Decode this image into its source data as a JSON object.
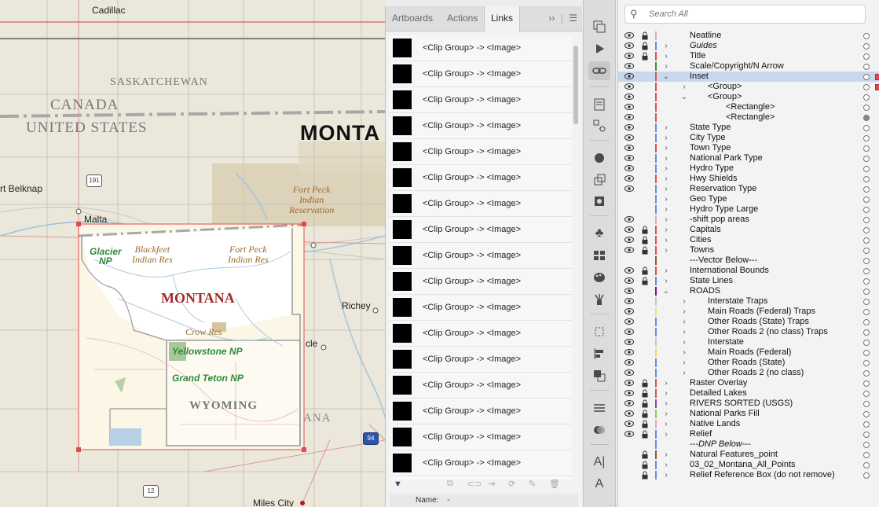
{
  "map": {
    "places": {
      "cadillac": "Cadillac",
      "fort_belknap": "rt Belknap",
      "malta": "Malta",
      "richey": "Richey",
      "circle": "cle",
      "miles_city": "Miles City"
    },
    "regions": {
      "saskatchewan": "SASKATCHEWAN",
      "canada": "CANADA",
      "united_states": "UNITED STATES",
      "montana_big": "MONTA",
      "ana_fragment": "ANA"
    },
    "reservations": {
      "fort_peck_main": "Fort Peck\nIndian\nReservation",
      "blackfeet": "Blackfeet\nIndian Res",
      "fort_peck_inset": "Fort Peck\nIndian Res",
      "crow": "Crow Res"
    },
    "parks": {
      "glacier": "Glacier\nNP",
      "yellowstone": "Yellowstone NP",
      "grand_teton": "Grand Teton NP"
    },
    "inset_labels": {
      "montana": "MONTANA",
      "wyoming": "WYOMING"
    },
    "shields": {
      "hwy191": "191",
      "hwy12": "12",
      "i94": "94"
    }
  },
  "links_panel": {
    "tabs": [
      "Artboards",
      "Actions",
      "Links"
    ],
    "active_tab": "Links",
    "items": [
      "<Clip Group> -> <Image>",
      "<Clip Group> -> <Image>",
      "<Clip Group> -> <Image>",
      "<Clip Group> -> <Image>",
      "<Clip Group> -> <Image>",
      "<Clip Group> -> <Image>",
      "<Clip Group> -> <Image>",
      "<Clip Group> -> <Image>",
      "<Clip Group> -> <Image>",
      "<Clip Group> -> <Image>",
      "<Clip Group> -> <Image>",
      "<Clip Group> -> <Image>",
      "<Clip Group> -> <Image>",
      "<Clip Group> -> <Image>",
      "<Clip Group> -> <Image>",
      "<Clip Group> -> <Image>",
      "<Clip Group> -> <Image>"
    ],
    "name_label": "Name:",
    "name_value": "-"
  },
  "layers_panel": {
    "search_placeholder": "Search All",
    "rows": [
      {
        "name": "Neatline",
        "indent": 0,
        "eye": true,
        "lock": true,
        "color": "#e8a0c8",
        "chev": ""
      },
      {
        "name": "Guides",
        "indent": 0,
        "eye": true,
        "lock": true,
        "color": "#6a8de0",
        "chev": ">",
        "italic": true
      },
      {
        "name": "Title",
        "indent": 0,
        "eye": true,
        "lock": true,
        "color": "#e05050",
        "chev": ">"
      },
      {
        "name": "Scale/Copyright/N Arrow",
        "indent": 0,
        "eye": true,
        "lock": false,
        "color": "#4a8a4a",
        "chev": ">"
      },
      {
        "name": "Inset",
        "indent": 0,
        "eye": true,
        "lock": false,
        "color": "#e05050",
        "chev": "v",
        "selected": true
      },
      {
        "name": "<Group>",
        "indent": 1,
        "eye": true,
        "lock": false,
        "color": "#e05050",
        "chev": ">"
      },
      {
        "name": "<Group>",
        "indent": 1,
        "eye": true,
        "lock": false,
        "color": "#e05050",
        "chev": "v"
      },
      {
        "name": "<Rectangle>",
        "indent": 2,
        "eye": true,
        "lock": false,
        "color": "#e05050",
        "chev": ""
      },
      {
        "name": "<Rectangle>",
        "indent": 2,
        "eye": true,
        "lock": false,
        "color": "#e05050",
        "chev": "",
        "filled": true
      },
      {
        "name": "State Type",
        "indent": 0,
        "eye": true,
        "lock": false,
        "color": "#6a8de0",
        "chev": ">"
      },
      {
        "name": "City Type",
        "indent": 0,
        "eye": true,
        "lock": false,
        "color": "#6a8de0",
        "chev": ">"
      },
      {
        "name": "Town Type",
        "indent": 0,
        "eye": true,
        "lock": false,
        "color": "#e05050",
        "chev": ">"
      },
      {
        "name": "National Park Type",
        "indent": 0,
        "eye": true,
        "lock": false,
        "color": "#6a8de0",
        "chev": ">"
      },
      {
        "name": "Hydro Type",
        "indent": 0,
        "eye": true,
        "lock": false,
        "color": "#6a8de0",
        "chev": ">"
      },
      {
        "name": "Hwy Shields",
        "indent": 0,
        "eye": true,
        "lock": false,
        "color": "#e05050",
        "chev": ">"
      },
      {
        "name": "Reservation Type",
        "indent": 0,
        "eye": true,
        "lock": false,
        "color": "#6a8de0",
        "chev": ">"
      },
      {
        "name": "Geo Type",
        "indent": 0,
        "eye": false,
        "lock": false,
        "color": "#6a8de0",
        "chev": ">"
      },
      {
        "name": "Hydro Type Large",
        "indent": 0,
        "eye": false,
        "lock": false,
        "color": "#6a8de0",
        "chev": ">"
      },
      {
        "name": "-shift pop areas",
        "indent": 0,
        "eye": true,
        "lock": false,
        "color": "#e8a0c8",
        "chev": ">"
      },
      {
        "name": "Capitals",
        "indent": 0,
        "eye": true,
        "lock": true,
        "color": "#e05050",
        "chev": ">"
      },
      {
        "name": "Cities",
        "indent": 0,
        "eye": true,
        "lock": true,
        "color": "#e05050",
        "chev": ">"
      },
      {
        "name": "Towns",
        "indent": 0,
        "eye": true,
        "lock": true,
        "color": "#e05050",
        "chev": ">"
      },
      {
        "name": "---Vector Below---",
        "indent": 0,
        "eye": false,
        "lock": false,
        "color": "#8a5a2a",
        "chev": ""
      },
      {
        "name": "International Bounds",
        "indent": 0,
        "eye": true,
        "lock": true,
        "color": "#e05050",
        "chev": ">"
      },
      {
        "name": "State Lines",
        "indent": 0,
        "eye": true,
        "lock": true,
        "color": "#6a8de0",
        "chev": ">"
      },
      {
        "name": "ROADS",
        "indent": 0,
        "eye": true,
        "lock": false,
        "color": "#6a1a8a",
        "chev": "v"
      },
      {
        "name": "Interstate Traps",
        "indent": 1,
        "eye": true,
        "lock": false,
        "color": "#c8c8c8",
        "chev": ">"
      },
      {
        "name": "Main Roads (Federal) Traps",
        "indent": 1,
        "eye": true,
        "lock": false,
        "color": "#f0e070",
        "chev": ">"
      },
      {
        "name": "Other Roads (State) Traps",
        "indent": 1,
        "eye": true,
        "lock": false,
        "color": "#6a8de0",
        "chev": ">"
      },
      {
        "name": "Other Roads 2 (no class) Traps",
        "indent": 1,
        "eye": true,
        "lock": false,
        "color": "#6a8de0",
        "chev": ">"
      },
      {
        "name": "Interstate",
        "indent": 1,
        "eye": true,
        "lock": false,
        "color": "#c8c8c8",
        "chev": ">"
      },
      {
        "name": "Main Roads (Federal)",
        "indent": 1,
        "eye": true,
        "lock": false,
        "color": "#f0e070",
        "chev": ">"
      },
      {
        "name": "Other Roads (State)",
        "indent": 1,
        "eye": true,
        "lock": false,
        "color": "#6a8de0",
        "chev": ">"
      },
      {
        "name": "Other Roads 2 (no class)",
        "indent": 1,
        "eye": true,
        "lock": false,
        "color": "#6a8de0",
        "chev": ">"
      },
      {
        "name": "Raster Overlay",
        "indent": 0,
        "eye": true,
        "lock": true,
        "color": "#e05050",
        "chev": ">"
      },
      {
        "name": "Detailed Lakes",
        "indent": 0,
        "eye": true,
        "lock": true,
        "color": "#e05050",
        "chev": ">"
      },
      {
        "name": "RIVERS SORTED (USGS)",
        "indent": 0,
        "eye": true,
        "lock": true,
        "color": "#8a4aa8",
        "chev": ">"
      },
      {
        "name": "National Parks Fill",
        "indent": 0,
        "eye": true,
        "lock": true,
        "color": "#8ad04a",
        "chev": ">"
      },
      {
        "name": "Native Lands",
        "indent": 0,
        "eye": true,
        "lock": true,
        "color": "#e8a0c8",
        "chev": ">"
      },
      {
        "name": "Relief",
        "indent": 0,
        "eye": true,
        "lock": true,
        "color": "#6a8de0",
        "chev": ">"
      },
      {
        "name": "---DNP Below---",
        "indent": 0,
        "eye": false,
        "lock": false,
        "color": "#6a8de0",
        "chev": "",
        "italic": true
      },
      {
        "name": "Natural Features_point",
        "indent": 0,
        "eye": false,
        "lock": true,
        "color": "#8a5a2a",
        "chev": ">"
      },
      {
        "name": "03_02_Montana_All_Points",
        "indent": 0,
        "eye": false,
        "lock": true,
        "color": "#6a8de0",
        "chev": ">"
      },
      {
        "name": "Relief Reference Box (do not remove)",
        "indent": 0,
        "eye": false,
        "lock": true,
        "color": "#6a8de0",
        "chev": ">"
      }
    ]
  },
  "colors": {
    "selection_red": "#e24a4a",
    "selected_row": "#c9d7ef",
    "park_green": "#2f8a3b",
    "montana_red": "#a42a2a"
  }
}
